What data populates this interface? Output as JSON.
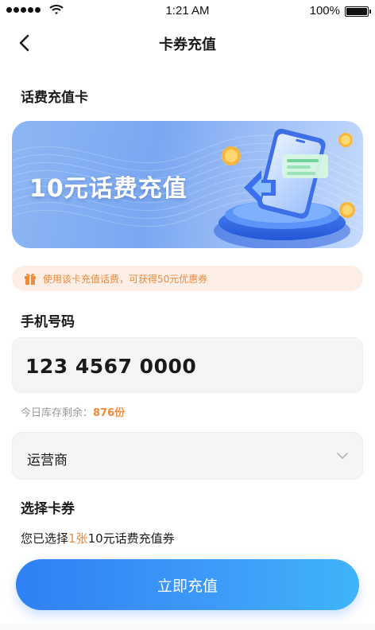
{
  "status_bar": {
    "time": "1:21 AM",
    "battery": "100%"
  },
  "nav": {
    "title": "卡券充值",
    "back_icon": "chevron-left-icon"
  },
  "section_card": {
    "title": "话费充值卡"
  },
  "banner": {
    "text": "10元话费充值",
    "colors": {
      "start": "#8db6f3",
      "end": "#c7dbfb"
    }
  },
  "tip": {
    "text": "使用该卡充值话费，可获得50元优惠券",
    "icon": "gift-icon",
    "color": "#f08a3c"
  },
  "phone": {
    "label": "手机号码",
    "value": "123 4567 0000"
  },
  "stock": {
    "label": "今日库存剩余：",
    "value": "876份"
  },
  "carrier": {
    "label": "运营商",
    "icon": "chevron-down-icon"
  },
  "coupon_section": {
    "title": "选择卡券"
  },
  "selection": {
    "prefix": "您已选择",
    "count": "1张",
    "suffix": "10元话费充值券"
  },
  "submit": {
    "label": "立即充值",
    "color": "#2f80f5"
  }
}
